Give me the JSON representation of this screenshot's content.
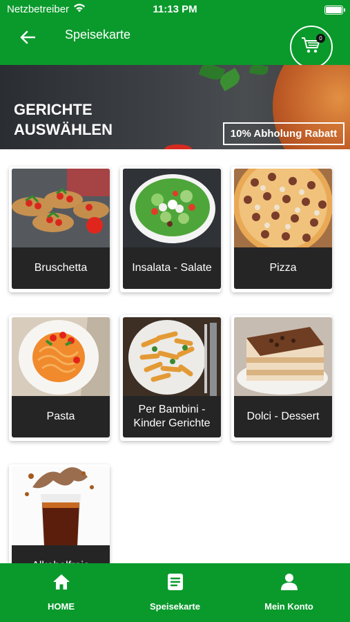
{
  "status_bar": {
    "carrier": "Netzbetreiber",
    "time": "11:13 PM",
    "icons": [
      "wifi-icon",
      "battery-icon"
    ]
  },
  "app_bar": {
    "title": "Speisekarte",
    "back_icon": "arrow-left-icon",
    "cart_icon": "shopping-cart-icon",
    "cart_count": "0"
  },
  "banner": {
    "title": "GERICHTE AUSWÄHLEN",
    "promo": "10% Abholung Rabatt"
  },
  "categories": [
    {
      "label": "Bruschetta"
    },
    {
      "label": "Insalata - Salate"
    },
    {
      "label": "Pizza"
    },
    {
      "label": "Pasta"
    },
    {
      "label": "Per Bambini - Kinder Gerichte"
    },
    {
      "label": "Dolci - Dessert"
    },
    {
      "label": "Alkoholfreie"
    }
  ],
  "bottom_nav": {
    "items": [
      {
        "label": "HOME",
        "icon": "home-icon"
      },
      {
        "label": "Speisekarte",
        "icon": "menu-list-icon"
      },
      {
        "label": "Mein Konto",
        "icon": "user-icon"
      }
    ]
  },
  "colors": {
    "brand_green": "#0a9a2c",
    "card_label_bg": "#252525"
  }
}
